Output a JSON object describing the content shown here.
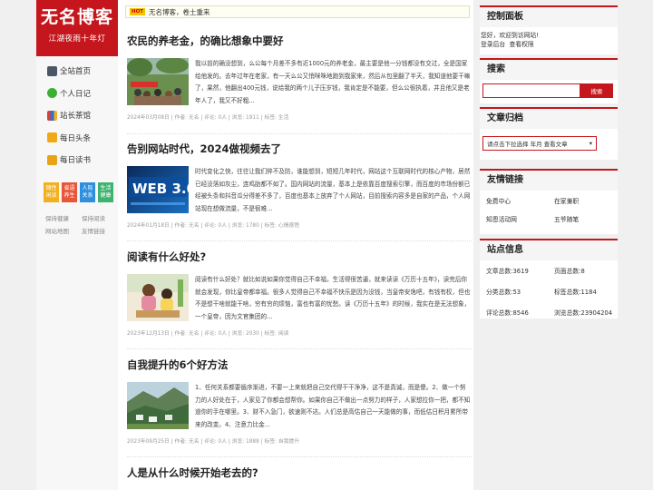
{
  "logo": {
    "title": "无名博客",
    "tagline": "江湖夜雨十年灯"
  },
  "nav": [
    {
      "label": "全站首页",
      "icon": "home-icon"
    },
    {
      "label": "个人日记",
      "icon": "wechat-icon"
    },
    {
      "label": "站长茶馆",
      "icon": "tea-icon"
    },
    {
      "label": "每日头条",
      "icon": "news-icon"
    },
    {
      "label": "每日读书",
      "icon": "book-icon"
    }
  ],
  "tiles": [
    {
      "line1": "随性",
      "line2": "闲谈",
      "color": "#f2b01e"
    },
    {
      "line1": "省语",
      "line2": "养生",
      "color": "#e7563a"
    },
    {
      "line1": "人际",
      "line2": "关系",
      "color": "#2e8fe0"
    },
    {
      "line1": "生活",
      "line2": "健康",
      "color": "#3bb46e"
    }
  ],
  "side_links": [
    "保持健康",
    "保持阅读",
    "网站地图",
    "友情链接"
  ],
  "notice": {
    "badge": "HOT",
    "text": "无名博客，卷土重来"
  },
  "posts": [
    {
      "title": "农民的养老金，的确比想象中要好",
      "excerpt": "我以前的确没想到，么公每个月差不多有近1000元的养老金，最主要是他一分钱都没有交过，全是国家给他发的。去年过年在老家，有一天么公又悄咪咪地跑到我家来，然后从包里翻了半天，我知道他要干嘛了，果然，他翻出400元钱，说给我的两个儿子压岁钱，我肯定是不能要，但么公很执着，并且他又是老年人了，我又不好粗...",
      "meta": "2024年03月08日 | 作者: 无名 | 评论: 0人 | 浏览: 1911 | 标签: 生活",
      "thumb": "crowd-photo"
    },
    {
      "title": "告别网站时代，2024做视频去了",
      "excerpt": "时代变化之快，往往让我们猝不及防，谁能想到，短短几年时代，网站这个互联网时代的核心产物，居然已经没落如灰尘，连鸡肋都不如了。国内网站的流量，基本上是依靠百度搜索引擎，而百度的市场份额已经被头条和抖音瓜分得差不多了，百度也基本上放弃了个人网站，目前搜索内容多是自家的产品，个人网站现在想做流量，不是很难...",
      "meta": "2024年01月18日 | 作者: 无名 | 评论: 0人 | 浏览: 1780 | 标签: 心情感悟",
      "thumb": "web3-photo"
    },
    {
      "title": "阅读有什么好处?",
      "excerpt": "阅读有什么好处？就比如说如果你觉得自己不幸福，生活得很苦逼，就来读读《万历十五年》，读完后你就会发现，你比皇帝都幸福。很多人觉得自己不幸福不快乐是因为没钱，当皇帝安逸吧，有钱有权，但也不是想干啥就能干啥，穷有穷的烦恼，富也有富的忧愁。读《万历十五年》的时候，我实在是无法想象，一个皇帝，因为文官集团的...",
      "meta": "2023年12月13日 | 作者: 无名 | 评论: 0人 | 浏览: 2030 | 标签: 阅读",
      "thumb": "reading-photo"
    },
    {
      "title": "自我提升的6个好方法",
      "excerpt": "1、任何关系都要循序渐进，不要一上来就把自己交代得干干净净，这不是真诚，而是傻。2、做一个努力的人好处在于，人家见了你都会想帮你。如果你自己不做出一点努力的样子，人家想拉你一把，都不知道你的手在哪里。3、财不入急门，欲速则不达。人们总是高估自己一天能做的事，而低估日积月累所带来的改变。4、注意力比金...",
      "meta": "2023年09月25日 | 作者: 无名 | 评论: 0人 | 浏览: 1888 | 标签: 自我提升",
      "thumb": "village-photo"
    },
    {
      "title": "人是从什么时候开始老去的?",
      "excerpt": "",
      "meta": "",
      "thumb": ""
    }
  ],
  "panel": {
    "title": "控制面板",
    "welcome": "您好，欢迎到访网站!",
    "login": "登录后台",
    "rights": "查看权限"
  },
  "search": {
    "title": "搜索",
    "button": "搜索",
    "value": ""
  },
  "archive": {
    "title": "文章归档",
    "select": "请点击下拉选择 年月 查看文章"
  },
  "friends": {
    "title": "友情链接",
    "items": [
      "免费中心",
      "在家兼职",
      "知恩活动网",
      "五爷随笔"
    ]
  },
  "stats": {
    "title": "站点信息",
    "items": [
      "文章总数:3619",
      "页面总数:8",
      "分类总数:53",
      "标签总数:1184",
      "评论总数:8546",
      "浏览总数:23904204"
    ]
  },
  "colors": {
    "brand": "#c4161c"
  }
}
